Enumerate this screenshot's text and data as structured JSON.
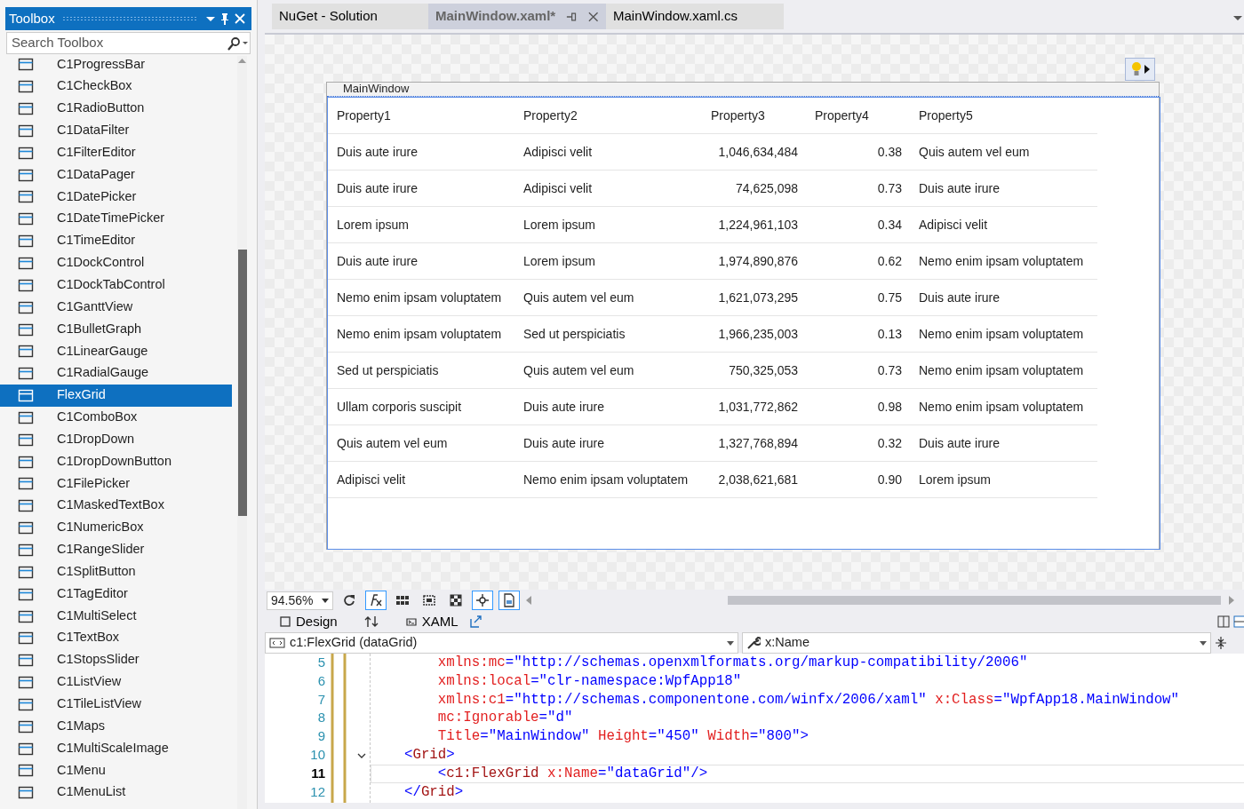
{
  "toolbox": {
    "title": "Toolbox",
    "search": {
      "placeholder": "Search Toolbox"
    },
    "items": [
      {
        "label": "C1ProgressBar",
        "selected": false
      },
      {
        "label": "C1CheckBox",
        "selected": false
      },
      {
        "label": "C1RadioButton",
        "selected": false
      },
      {
        "label": "C1DataFilter",
        "selected": false
      },
      {
        "label": "C1FilterEditor",
        "selected": false
      },
      {
        "label": "C1DataPager",
        "selected": false
      },
      {
        "label": "C1DatePicker",
        "selected": false
      },
      {
        "label": "C1DateTimePicker",
        "selected": false
      },
      {
        "label": "C1TimeEditor",
        "selected": false
      },
      {
        "label": "C1DockControl",
        "selected": false
      },
      {
        "label": "C1DockTabControl",
        "selected": false
      },
      {
        "label": "C1GanttView",
        "selected": false
      },
      {
        "label": "C1BulletGraph",
        "selected": false
      },
      {
        "label": "C1LinearGauge",
        "selected": false
      },
      {
        "label": "C1RadialGauge",
        "selected": false
      },
      {
        "label": "FlexGrid",
        "selected": true
      },
      {
        "label": "C1ComboBox",
        "selected": false
      },
      {
        "label": "C1DropDown",
        "selected": false
      },
      {
        "label": "C1DropDownButton",
        "selected": false
      },
      {
        "label": "C1FilePicker",
        "selected": false
      },
      {
        "label": "C1MaskedTextBox",
        "selected": false
      },
      {
        "label": "C1NumericBox",
        "selected": false
      },
      {
        "label": "C1RangeSlider",
        "selected": false
      },
      {
        "label": "C1SplitButton",
        "selected": false
      },
      {
        "label": "C1TagEditor",
        "selected": false
      },
      {
        "label": "C1MultiSelect",
        "selected": false
      },
      {
        "label": "C1TextBox",
        "selected": false
      },
      {
        "label": "C1StopsSlider",
        "selected": false
      },
      {
        "label": "C1ListView",
        "selected": false
      },
      {
        "label": "C1TileListView",
        "selected": false
      },
      {
        "label": "C1Maps",
        "selected": false
      },
      {
        "label": "C1MultiScaleImage",
        "selected": false
      },
      {
        "label": "C1Menu",
        "selected": false
      },
      {
        "label": "C1MenuList",
        "selected": false
      }
    ]
  },
  "tabs": [
    {
      "label": "NuGet - Solution",
      "selected": false
    },
    {
      "label": "MainWindow.xaml*",
      "selected": true
    },
    {
      "label": "MainWindow.xaml.cs",
      "selected": false
    }
  ],
  "designer": {
    "window_title": "MainWindow",
    "grid": {
      "columns": [
        "Property1",
        "Property2",
        "Property3",
        "Property4",
        "Property5"
      ],
      "rows": [
        [
          "Duis aute irure",
          "Adipisci velit",
          "1,046,634,484",
          "0.38",
          "Quis autem vel eum"
        ],
        [
          "Duis aute irure",
          "Adipisci velit",
          "74,625,098",
          "0.73",
          "Duis aute irure"
        ],
        [
          "Lorem ipsum",
          "Lorem ipsum",
          "1,224,961,103",
          "0.34",
          "Adipisci velit"
        ],
        [
          "Duis aute irure",
          "Lorem ipsum",
          "1,974,890,876",
          "0.62",
          "Nemo enim ipsam voluptatem"
        ],
        [
          "Nemo enim ipsam voluptatem",
          "Quis autem vel eum",
          "1,621,073,295",
          "0.75",
          "Duis aute irure"
        ],
        [
          "Nemo enim ipsam voluptatem",
          "Sed ut perspiciatis",
          "1,966,235,003",
          "0.13",
          "Nemo enim ipsam voluptatem"
        ],
        [
          "Sed ut perspiciatis",
          "Quis autem vel eum",
          "750,325,053",
          "0.73",
          "Nemo enim ipsam voluptatem"
        ],
        [
          "Ullam corporis suscipit",
          "Duis aute irure",
          "1,031,772,862",
          "0.98",
          "Nemo enim ipsam voluptatem"
        ],
        [
          "Quis autem vel eum",
          "Duis aute irure",
          "1,327,768,894",
          "0.32",
          "Duis aute irure"
        ],
        [
          "Adipisci velit",
          "Nemo enim ipsam voluptatem",
          "2,038,621,681",
          "0.90",
          "Lorem ipsum"
        ]
      ]
    }
  },
  "toolbar": {
    "zoom": "94.56%"
  },
  "pane_tabs": [
    "Design",
    "XAML"
  ],
  "element_selector": "c1:FlexGrid (dataGrid)",
  "member_selector": "x:Name",
  "code": [
    {
      "number": "5",
      "current": false,
      "foldable": false,
      "tokens": [
        {
          "kind": "name",
          "text": "        xmlns:mc"
        },
        {
          "kind": "punct",
          "text": "=\"http://schemas.openxmlformats.org/markup-compatibility/2006\""
        }
      ]
    },
    {
      "number": "6",
      "current": false,
      "foldable": false,
      "tokens": [
        {
          "kind": "name",
          "text": "        xmlns:local"
        },
        {
          "kind": "punct",
          "text": "=\"clr-namespace:WpfApp18\""
        }
      ]
    },
    {
      "number": "7",
      "current": false,
      "foldable": false,
      "tokens": [
        {
          "kind": "name",
          "text": "        xmlns:c1"
        },
        {
          "kind": "punct",
          "text": "=\"http://schemas.componentone.com/winfx/2006/xaml\" "
        },
        {
          "kind": "name",
          "text": "x:Class"
        },
        {
          "kind": "punct",
          "text": "=\"WpfApp18.MainWindow\""
        }
      ]
    },
    {
      "number": "8",
      "current": false,
      "foldable": false,
      "tokens": [
        {
          "kind": "name",
          "text": "        mc:Ignorable"
        },
        {
          "kind": "punct",
          "text": "=\"d\""
        }
      ]
    },
    {
      "number": "9",
      "current": false,
      "foldable": false,
      "tokens": [
        {
          "kind": "name",
          "text": "        Title"
        },
        {
          "kind": "punct",
          "text": "=\"MainWindow\" "
        },
        {
          "kind": "name",
          "text": "Height"
        },
        {
          "kind": "punct",
          "text": "=\"450\" "
        },
        {
          "kind": "name",
          "text": "Width"
        },
        {
          "kind": "punct",
          "text": "=\"800\">"
        }
      ]
    },
    {
      "number": "10",
      "current": false,
      "foldable": true,
      "tokens": [
        {
          "kind": "punct",
          "text": "    <"
        },
        {
          "kind": "tag",
          "text": "Grid"
        },
        {
          "kind": "punct",
          "text": ">"
        }
      ]
    },
    {
      "number": "11",
      "current": true,
      "foldable": false,
      "tokens": [
        {
          "kind": "punct",
          "text": "        <"
        },
        {
          "kind": "tag",
          "text": "c1:FlexGrid"
        },
        {
          "kind": "name",
          "text": " x:Name"
        },
        {
          "kind": "punct",
          "text": "=\"dataGrid\"/>"
        }
      ]
    },
    {
      "number": "12",
      "current": false,
      "foldable": false,
      "tokens": [
        {
          "kind": "punct",
          "text": "    </"
        },
        {
          "kind": "tag",
          "text": "Grid"
        },
        {
          "kind": "punct",
          "text": ">"
        }
      ]
    }
  ]
}
